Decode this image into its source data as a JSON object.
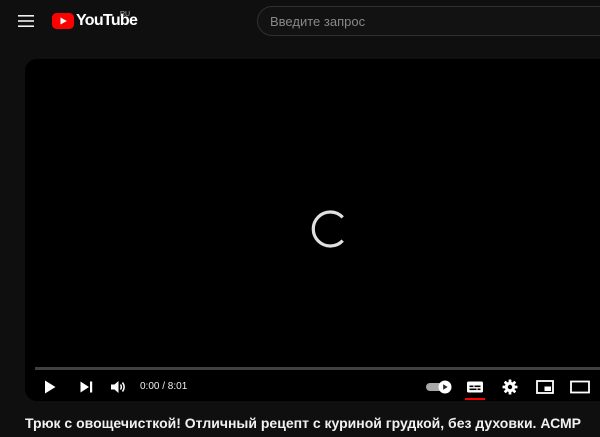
{
  "header": {
    "logo_text": "YouTube",
    "region": "RU",
    "search_placeholder": "Введите запрос"
  },
  "player": {
    "state": "loading",
    "time_display": "0:00 / 8:01",
    "progress": 0.0,
    "autoplay_on": true,
    "subtitles_on": true,
    "icons": {
      "play": "play-icon",
      "next": "next-icon",
      "volume": "volume-icon",
      "autoplay": "autoplay-toggle-icon",
      "subtitles": "subtitles-icon",
      "settings": "gear-icon",
      "miniplayer": "miniplayer-icon",
      "theater": "theater-mode-icon"
    }
  },
  "video": {
    "title": "Трюк с овощечисткой! Отличный рецепт с куриной грудкой, без духовки. АСМР"
  },
  "colors": {
    "brand_red": "#ff0000",
    "background": "#0f0f0f",
    "player_bg": "#000000"
  }
}
